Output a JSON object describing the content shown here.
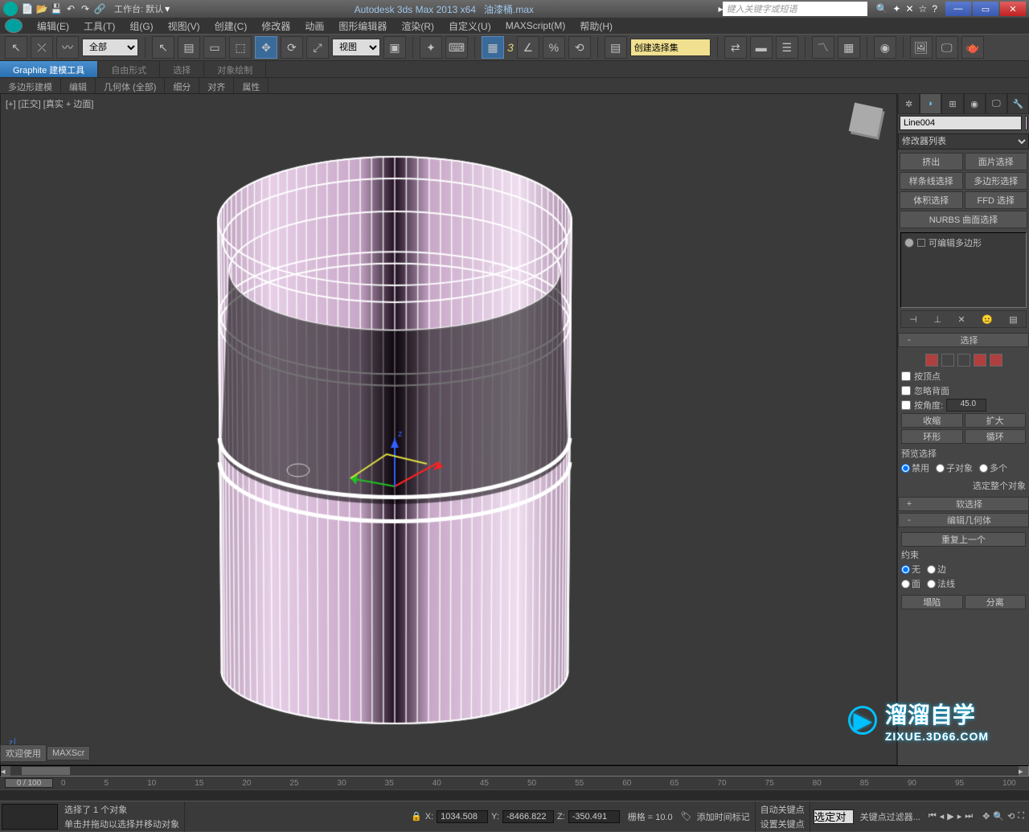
{
  "title": {
    "app": "Autodesk 3ds Max  2013 x64",
    "file": "油漆桶.max",
    "workspace": "工作台: 默认",
    "search_placeholder": "键入关键字或短语"
  },
  "menubar": [
    "编辑(E)",
    "工具(T)",
    "组(G)",
    "视图(V)",
    "创建(C)",
    "修改器",
    "动画",
    "图形编辑器",
    "渲染(R)",
    "自定义(U)",
    "MAXScript(M)",
    "帮助(H)"
  ],
  "toolbar": {
    "filter": "全部",
    "viewlbl": "视图",
    "createset": "创建选择集"
  },
  "ribbon": {
    "tabs": [
      "Graphite 建模工具",
      "自由形式",
      "选择",
      "对象绘制"
    ],
    "subtabs": [
      "多边形建模",
      "编辑",
      "几何体 (全部)",
      "细分",
      "对齐",
      "属性"
    ]
  },
  "viewport": {
    "label": "[+] [正交] [真实 + 边面]"
  },
  "panel": {
    "object_name": "Line004",
    "modlist": "修改器列表",
    "buttons": {
      "extrude": "挤出",
      "facesel": "面片选择",
      "splinesel": "样条线选择",
      "polysel": "多边形选择",
      "volsel": "体积选择",
      "ffdsel": "FFD 选择",
      "nurbs": "NURBS 曲面选择"
    },
    "stack_item": "可编辑多边形",
    "roll_select": {
      "title": "选择",
      "by_vertex": "按顶点",
      "ignore_back": "忽略背面",
      "by_angle": "按角度:",
      "angle_val": "45.0",
      "shrink": "收缩",
      "grow": "扩大",
      "ring": "环形",
      "loop": "循环",
      "preview": "预览选择",
      "r_disable": "禁用",
      "r_subobj": "子对象",
      "r_multi": "多个",
      "whole": "选定整个对象"
    },
    "roll_soft": "软选择",
    "roll_editgeo": {
      "title": "编辑几何体",
      "repeat": "重复上一个",
      "constraint": "约束",
      "r_none": "无",
      "r_edge": "边",
      "r_face": "面",
      "r_normal": "法线"
    },
    "collapse": "塌陷",
    "detach": "分离"
  },
  "timeline": {
    "frame": "0 / 100",
    "ticks": [
      "0",
      "5",
      "10",
      "15",
      "20",
      "25",
      "30",
      "35",
      "40",
      "45",
      "50",
      "55",
      "60",
      "65",
      "70",
      "75",
      "80",
      "85",
      "90",
      "95",
      "100"
    ]
  },
  "status": {
    "welcome": "欢迎使用",
    "maxscript": "MAXScr",
    "sel": "选择了 1 个对象",
    "hint": "单击并拖动以选择并移动对象",
    "x": "1034.508",
    "y": "-8466.822",
    "z": "-350.491",
    "grid": "栅格 = 10.0",
    "autokey": "自动关键点",
    "setkey": "设置关键点",
    "addtime": "添加时间标记",
    "keyfilter": "关键点过滤器...",
    "selected": "选定对"
  },
  "watermark": {
    "text": "溜溜自学",
    "url": "ZIXUE.3D66.COM"
  }
}
